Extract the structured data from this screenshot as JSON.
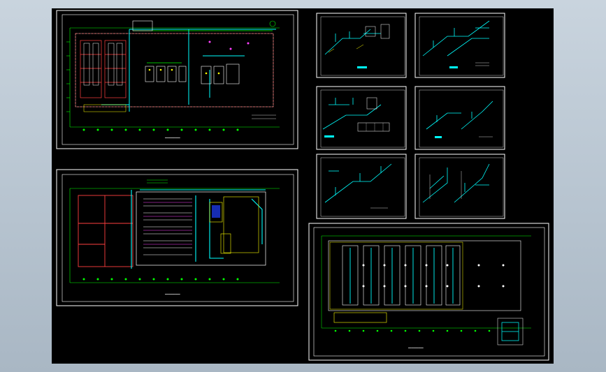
{
  "viewport": {
    "background": "#bfcbd6",
    "canvas_bg": "#000000"
  },
  "colors": {
    "frame": "#ffffff",
    "axis": "#00ff00",
    "wall": "#ff4040",
    "pipe": "#00ffff",
    "accent": "#ffff00",
    "blue": "#4060ff",
    "magenta": "#ff40ff"
  },
  "sheets": [
    {
      "name": "plan-top",
      "kind": "plan"
    },
    {
      "name": "plan-bottom",
      "kind": "plan"
    },
    {
      "name": "iso-1",
      "kind": "isometric"
    },
    {
      "name": "iso-2",
      "kind": "isometric"
    },
    {
      "name": "iso-3",
      "kind": "isometric"
    },
    {
      "name": "iso-4",
      "kind": "isometric"
    },
    {
      "name": "iso-5",
      "kind": "isometric"
    },
    {
      "name": "iso-6",
      "kind": "isometric"
    },
    {
      "name": "roof-plan",
      "kind": "plan"
    }
  ]
}
